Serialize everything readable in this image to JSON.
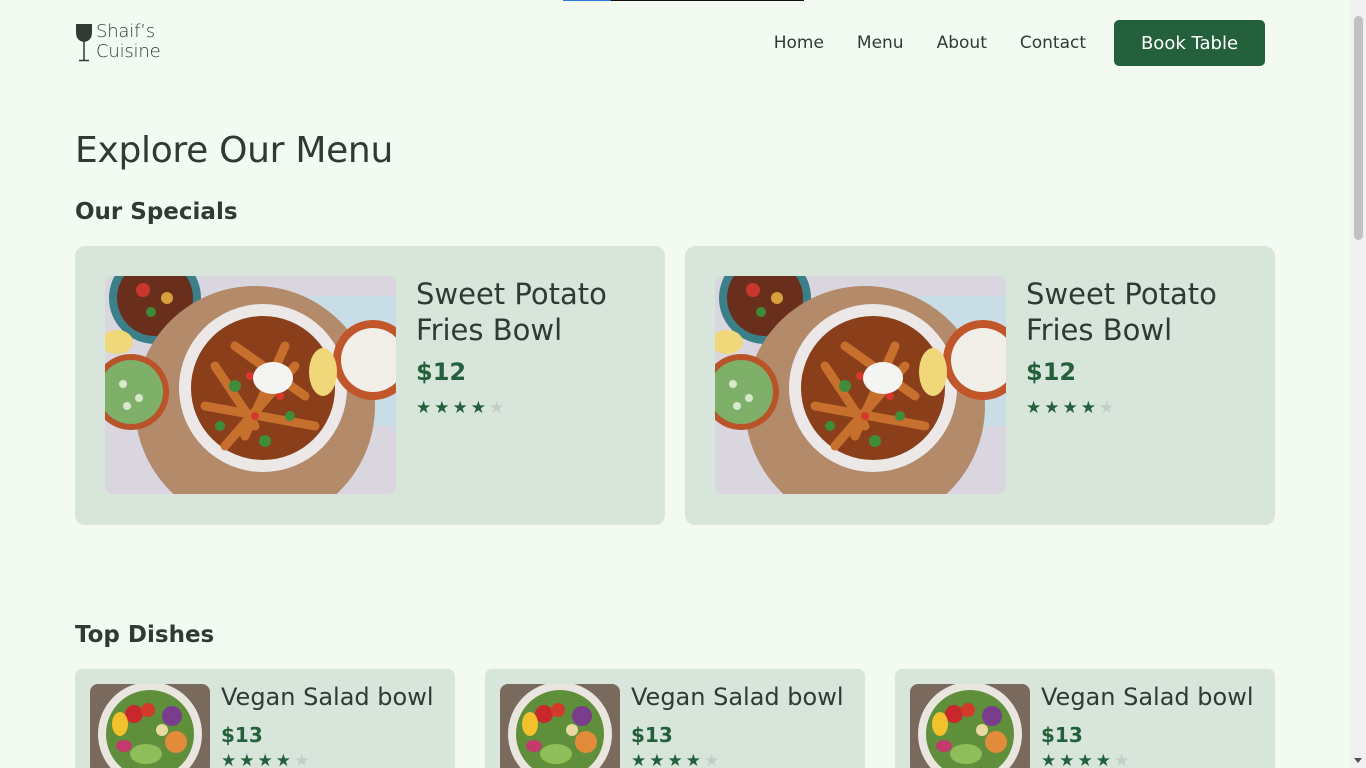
{
  "brand": {
    "line1": "Shaif’s",
    "line2": "Cuisine"
  },
  "nav": {
    "items": [
      "Home",
      "Menu",
      "About",
      "Contact"
    ],
    "cta": "Book Table"
  },
  "page": {
    "title": "Explore Our Menu"
  },
  "specials": {
    "title": "Our Specials",
    "items": [
      {
        "name": "Sweet Potato Fries Bowl",
        "price": "$12",
        "rating": 4,
        "max_rating": 5,
        "image": "sweet-potato-fries-bowl-photo"
      },
      {
        "name": "Sweet Potato Fries Bowl",
        "price": "$12",
        "rating": 4,
        "max_rating": 5,
        "image": "sweet-potato-fries-bowl-photo"
      }
    ]
  },
  "top_dishes": {
    "title": "Top Dishes",
    "items": [
      {
        "name": "Vegan Salad bowl",
        "price": "$13",
        "rating": 4,
        "max_rating": 5,
        "image": "vegan-salad-bowl-photo"
      },
      {
        "name": "Vegan Salad bowl",
        "price": "$13",
        "rating": 4,
        "max_rating": 5,
        "image": "vegan-salad-bowl-photo"
      },
      {
        "name": "Vegan Salad bowl",
        "price": "$13",
        "rating": 4,
        "max_rating": 5,
        "image": "vegan-salad-bowl-photo"
      }
    ]
  },
  "colors": {
    "background": "#f3faf2",
    "card": "#d7e5da",
    "accent": "#24603c",
    "text": "#2f3a33"
  },
  "icons": {
    "logo": "wine-glass-icon",
    "star": "star-icon"
  }
}
